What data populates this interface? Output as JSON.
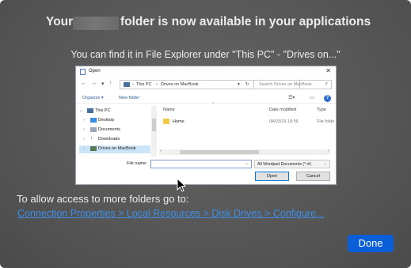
{
  "headline": {
    "prefix": "Your",
    "suffix": "folder is now available in your applications"
  },
  "subline": "You can find it in File Explorer under \"This PC\" - \"Drives on...\"",
  "dialog": {
    "title": "Open",
    "close": "✕",
    "breadcrumb": {
      "root": "This PC",
      "sep": "›",
      "leaf": "Drives on MacBook"
    },
    "search_placeholder": "Search Drives on MacBook",
    "organize": "Organize ▾",
    "new_folder": "New folder",
    "help": "?",
    "tree": [
      {
        "label": "This PC",
        "expanded": true
      },
      {
        "label": "Desktop"
      },
      {
        "label": "Documents"
      },
      {
        "label": "Downloads"
      },
      {
        "label": "Drives on MacBook",
        "selected": true
      }
    ],
    "columns": {
      "name": "Name",
      "date": "Date modified",
      "type": "Type"
    },
    "rows": [
      {
        "name": "Home",
        "date": "04/03/19 18:56",
        "type": "File folde"
      }
    ],
    "file_name_label": "File name:",
    "file_name_value": "",
    "file_type": "All Wordpad Documents (*.rtf,",
    "open_button": "Open",
    "cancel_button": "Cancel"
  },
  "allow_text": "To allow access to more folders go to:",
  "link_text": "Connection Properties > Local Resources > Disk Drives > Configure...",
  "done_button": "Done",
  "colors": {
    "accent": "#0a5ed7",
    "link": "#3d8ee8",
    "sheet": "#575757"
  }
}
